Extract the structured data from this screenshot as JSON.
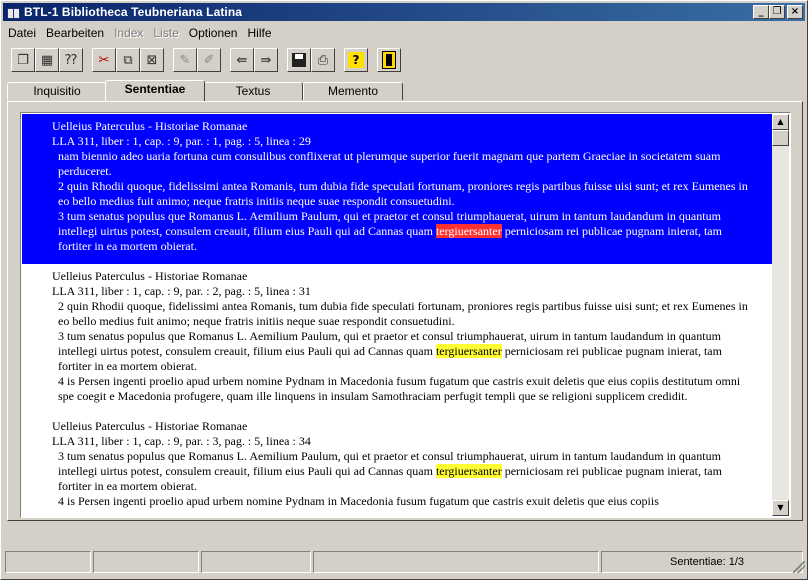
{
  "window": {
    "title": "BTL-1 Bibliotheca Teubneriana Latina",
    "minimize": "_",
    "restore": "❐",
    "close": "×"
  },
  "menu": [
    {
      "label": "Datei",
      "disabled": false
    },
    {
      "label": "Bearbeiten",
      "disabled": false
    },
    {
      "label": "Index",
      "disabled": true
    },
    {
      "label": "Liste",
      "disabled": true
    },
    {
      "label": "Optionen",
      "disabled": false
    },
    {
      "label": "Hilfe",
      "disabled": false
    }
  ],
  "toolbar": {
    "icons": [
      "copy-pages-icon",
      "table-icon",
      "query-icon",
      "cut-icon",
      "tree-icon",
      "filter-icon",
      "pen-icon",
      "pen-alt-icon",
      "import-icon",
      "export-icon",
      "save-icon",
      "print-icon",
      "help-icon",
      "exit-icon"
    ],
    "help_glyph": "?"
  },
  "tabs": [
    {
      "label": "Inquisitio",
      "active": false
    },
    {
      "label": "Sententiae",
      "active": true
    },
    {
      "label": "Textus",
      "active": false
    },
    {
      "label": "Memento",
      "active": false
    }
  ],
  "entries": [
    {
      "author": "Uelleius Paterculus - Historiae Romanae",
      "ref": "LLA 311, liber : 1, cap. : 9, par. : 1, pag. : 5, linea : 29",
      "selected": true,
      "paragraphs": [
        {
          "before": "nam biennio adeo uaria fortuna cum consulibus conflixerat ut plerumque superior fuerit magnam que partem Graeciae in societatem suam perduceret.",
          "hl": "",
          "after": ""
        },
        {
          "before": "2 quin Rhodii quoque, fidelissimi antea Romanis, tum dubia fide speculati fortunam, proniores regis partibus fuisse uisi sunt; et rex Eumenes in eo bello medius fuit animo; neque fratris initiis neque suae respondit consuetudini.",
          "hl": "",
          "after": ""
        },
        {
          "before": "3 tum senatus populus que Romanus L. Aemilium Paulum, qui et praetor et consul triumphauerat, uirum in tantum laudandum in quantum intellegi uirtus potest, consulem creauit, filium eius Pauli qui ad Cannas quam ",
          "hl": "tergiuersanter",
          "after": " perniciosam rei publicae pugnam inierat, tam fortiter in ea mortem obierat."
        }
      ]
    },
    {
      "author": "Uelleius Paterculus - Historiae Romanae",
      "ref": "LLA 311, liber : 1, cap. : 9, par. : 2, pag. : 5, linea : 31",
      "selected": false,
      "paragraphs": [
        {
          "before": "2 quin Rhodii quoque, fidelissimi antea Romanis, tum dubia fide speculati fortunam, proniores regis partibus fuisse uisi sunt; et rex Eumenes in eo bello medius fuit animo; neque fratris initiis neque suae respondit consuetudini.",
          "hl": "",
          "after": ""
        },
        {
          "before": "3 tum senatus populus que Romanus L. Aemilium Paulum, qui et praetor et consul triumphauerat, uirum in tantum laudandum in quantum intellegi uirtus potest, consulem creauit, filium eius Pauli qui ad Cannas quam ",
          "hl": "tergiuersanter",
          "after": " perniciosam rei publicae pugnam inierat, tam fortiter in ea mortem obierat."
        },
        {
          "before": "4 is Persen ingenti proelio apud urbem nomine Pydnam in Macedonia fusum fugatum que castris exuit deletis que eius copiis destitutum omni spe coegit e Macedonia profugere, quam ille linquens in insulam Samothraciam perfugit templi que se religioni supplicem credidit.",
          "hl": "",
          "after": ""
        }
      ]
    },
    {
      "author": "Uelleius Paterculus - Historiae Romanae",
      "ref": "LLA 311, liber : 1, cap. : 9, par. : 3, pag. : 5, linea : 34",
      "selected": false,
      "paragraphs": [
        {
          "before": "3 tum senatus populus que Romanus L. Aemilium Paulum, qui et praetor et consul triumphauerat, uirum in tantum laudandum in quantum intellegi uirtus potest, consulem creauit, filium eius Pauli qui ad Cannas quam ",
          "hl": "tergiuersanter",
          "after": " perniciosam rei publicae pugnam inierat, tam fortiter in ea mortem obierat."
        },
        {
          "before": "4 is Persen ingenti proelio apud urbem nomine Pydnam in Macedonia fusum fugatum que castris exuit deletis que eius copiis",
          "hl": "",
          "after": ""
        }
      ]
    }
  ],
  "scrollbar": {
    "up": "▲",
    "down": "▼"
  },
  "status": {
    "cells": [
      "",
      "",
      "",
      "",
      "Sententiae: 1/3"
    ]
  }
}
